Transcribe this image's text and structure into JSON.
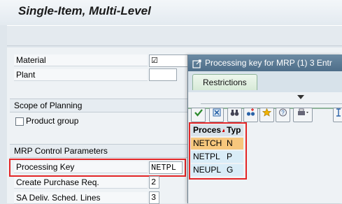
{
  "window": {
    "title": "Single-Item, Multi-Level"
  },
  "fields": {
    "material": {
      "label": "Material"
    },
    "plant": {
      "label": "Plant",
      "value": ""
    }
  },
  "scope": {
    "header": "Scope of Planning",
    "product_group_label": "Product group"
  },
  "mrp": {
    "header": "MRP Control Parameters",
    "processing_key": {
      "label": "Processing Key",
      "value": "NETPL"
    },
    "create_purchase_req": {
      "label": "Create Purchase Req.",
      "value": "2"
    },
    "sa_deliv_sched_lines": {
      "label": "SA Deliv. Sched. Lines",
      "value": "3"
    }
  },
  "popup": {
    "title": "Processing key for MRP (1)   3 Entr",
    "tab_label": "Restrictions",
    "columns": [
      "Proces",
      "Typ"
    ],
    "rows": [
      {
        "key": "NETCH",
        "type": "N"
      },
      {
        "key": "NETPL",
        "type": "P"
      },
      {
        "key": "NEUPL",
        "type": "G"
      }
    ]
  },
  "colors": {
    "highlight": "#e32526",
    "selected_row": "#f7c77d",
    "row_bg": "#d9ecf7"
  }
}
